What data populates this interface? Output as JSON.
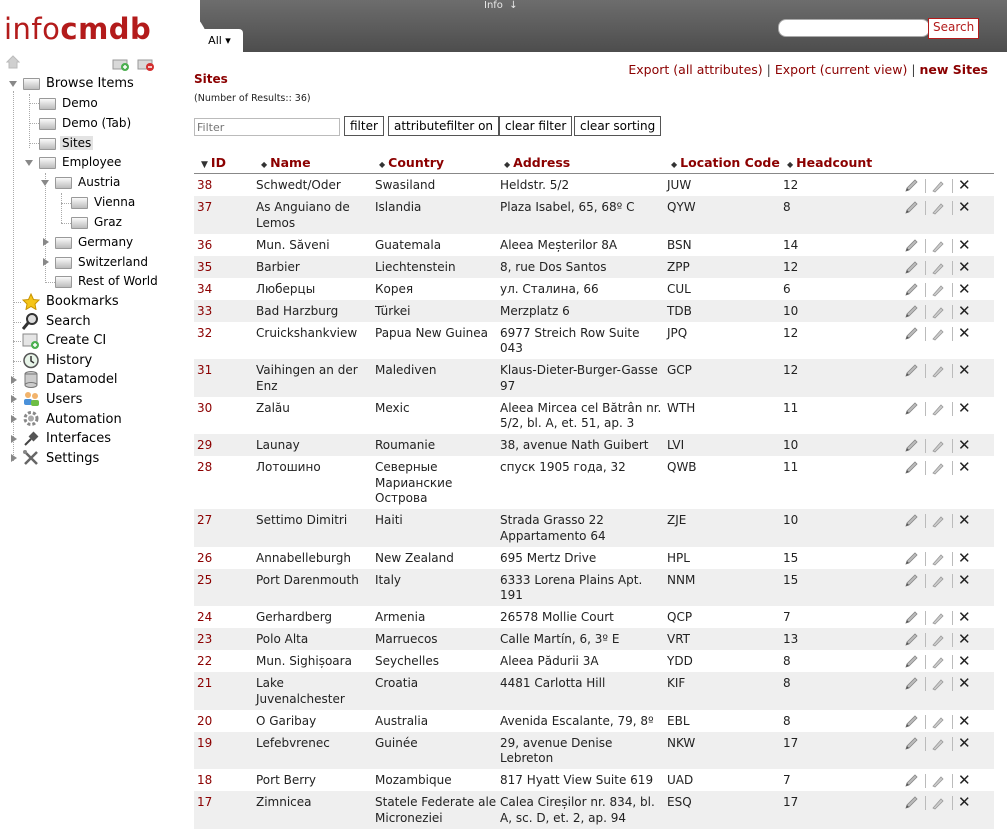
{
  "header": {
    "logo_part1": "info",
    "logo_part2": "cmdb",
    "info_label": "Info",
    "info_arrow": "↓",
    "tab_all": "All ▾",
    "search_placeholder": "",
    "search_button": "Search"
  },
  "sidebar": {
    "browse_items": "Browse Items",
    "demo": "Demo",
    "demo_tab": "Demo (Tab)",
    "sites": "Sites",
    "employee": "Employee",
    "austria": "Austria",
    "vienna": "Vienna",
    "graz": "Graz",
    "germany": "Germany",
    "switzerland": "Switzerland",
    "rest_of_world": "Rest of World",
    "bookmarks": "Bookmarks",
    "search": "Search",
    "create_ci": "Create CI",
    "history": "History",
    "datamodel": "Datamodel",
    "users": "Users",
    "automation": "Automation",
    "interfaces": "Interfaces",
    "settings": "Settings"
  },
  "main": {
    "title": "Sites",
    "result_count": "(Number of Results:: 36)",
    "export_all": "Export (all attributes)",
    "export_current": "Export (current view)",
    "new_sites": "new Sites",
    "separator": "|",
    "filter_placeholder": "Filter",
    "btn_filter": "filter",
    "btn_attributefilter": "attributefilter on",
    "btn_clear_filter": "clear filter",
    "btn_clear_sorting": "clear sorting"
  },
  "table": {
    "columns": [
      "ID",
      "Name",
      "Country",
      "Address",
      "Location Code",
      "Headcount"
    ],
    "sort_desc_glyph": "▼",
    "sort_both_glyph": "⬍",
    "rows": [
      {
        "id": "38",
        "name": [
          "Schwedt/Oder"
        ],
        "country": [
          "Swasiland"
        ],
        "address": [
          "Heldstr. 5/2"
        ],
        "code": "JUW",
        "headcount": "12"
      },
      {
        "id": "37",
        "name": [
          "As Anguiano de",
          "Lemos"
        ],
        "country": [
          "Islandia"
        ],
        "address": [
          "Plaza Isabel, 65, 68º C"
        ],
        "code": "QYW",
        "headcount": "8"
      },
      {
        "id": "36",
        "name": [
          "Mun. Săveni"
        ],
        "country": [
          "Guatemala"
        ],
        "address": [
          "Aleea Meșterilor 8A"
        ],
        "code": "BSN",
        "headcount": "14"
      },
      {
        "id": "35",
        "name": [
          "Barbier"
        ],
        "country": [
          "Liechtenstein"
        ],
        "address": [
          "8, rue Dos Santos"
        ],
        "code": "ZPP",
        "headcount": "12"
      },
      {
        "id": "34",
        "name": [
          "Люберцы"
        ],
        "country": [
          "Корея"
        ],
        "address": [
          "ул. Сталина, 66"
        ],
        "code": "CUL",
        "headcount": "6"
      },
      {
        "id": "33",
        "name": [
          "Bad Harzburg"
        ],
        "country": [
          "Türkei"
        ],
        "address": [
          "Merzplatz 6"
        ],
        "code": "TDB",
        "headcount": "10"
      },
      {
        "id": "32",
        "name": [
          "Cruickshankview"
        ],
        "country": [
          "Papua New Guinea"
        ],
        "address": [
          "6977 Streich Row Suite",
          "043"
        ],
        "code": "JPQ",
        "headcount": "12"
      },
      {
        "id": "31",
        "name": [
          "Vaihingen an der",
          "Enz"
        ],
        "country": [
          "Malediven"
        ],
        "address": [
          "Klaus-Dieter-Burger-Gasse",
          "97"
        ],
        "code": "GCP",
        "headcount": "12"
      },
      {
        "id": "30",
        "name": [
          "Zalău"
        ],
        "country": [
          "Mexic"
        ],
        "address": [
          "Aleea Mircea cel Bătrân nr.",
          "5/2, bl. A, et. 51, ap. 3"
        ],
        "code": "WTH",
        "headcount": "11"
      },
      {
        "id": "29",
        "name": [
          "Launay"
        ],
        "country": [
          "Roumanie"
        ],
        "address": [
          "38, avenue Nath Guibert"
        ],
        "code": "LVI",
        "headcount": "10"
      },
      {
        "id": "28",
        "name": [
          "Лотошино"
        ],
        "country": [
          "Северные",
          "Марианские",
          "Острова"
        ],
        "address": [
          "спуск 1905 года, 32"
        ],
        "code": "QWB",
        "headcount": "11"
      },
      {
        "id": "27",
        "name": [
          "Settimo Dimitri"
        ],
        "country": [
          "Haiti"
        ],
        "address": [
          "Strada Grasso 22",
          "Appartamento 64"
        ],
        "code": "ZJE",
        "headcount": "10"
      },
      {
        "id": "26",
        "name": [
          "Annabelleburgh"
        ],
        "country": [
          "New Zealand"
        ],
        "address": [
          "695 Mertz Drive"
        ],
        "code": "HPL",
        "headcount": "15"
      },
      {
        "id": "25",
        "name": [
          "Port Darenmouth"
        ],
        "country": [
          "Italy"
        ],
        "address": [
          "6333 Lorena Plains Apt.",
          "191"
        ],
        "code": "NNM",
        "headcount": "15"
      },
      {
        "id": "24",
        "name": [
          "Gerhardberg"
        ],
        "country": [
          "Armenia"
        ],
        "address": [
          "26578 Mollie Court"
        ],
        "code": "QCP",
        "headcount": "7"
      },
      {
        "id": "23",
        "name": [
          "Polo Alta"
        ],
        "country": [
          "Marruecos"
        ],
        "address": [
          "Calle Martín, 6, 3º E"
        ],
        "code": "VRT",
        "headcount": "13"
      },
      {
        "id": "22",
        "name": [
          "Mun. Sighișoara"
        ],
        "country": [
          "Seychelles"
        ],
        "address": [
          "Aleea Pădurii 3A"
        ],
        "code": "YDD",
        "headcount": "8"
      },
      {
        "id": "21",
        "name": [
          "Lake",
          "Juvenalchester"
        ],
        "country": [
          "Croatia"
        ],
        "address": [
          "4481 Carlotta Hill"
        ],
        "code": "KIF",
        "headcount": "8"
      },
      {
        "id": "20",
        "name": [
          "O Garibay"
        ],
        "country": [
          "Australia"
        ],
        "address": [
          "Avenida Escalante, 79, 8º"
        ],
        "code": "EBL",
        "headcount": "8"
      },
      {
        "id": "19",
        "name": [
          "Lefebvrenec"
        ],
        "country": [
          "Guinée"
        ],
        "address": [
          "29, avenue Denise",
          "Lebreton"
        ],
        "code": "NKW",
        "headcount": "17"
      },
      {
        "id": "18",
        "name": [
          "Port Berry"
        ],
        "country": [
          "Mozambique"
        ],
        "address": [
          "817 Hyatt View Suite 619"
        ],
        "code": "UAD",
        "headcount": "7"
      },
      {
        "id": "17",
        "name": [
          "Zimnicea"
        ],
        "country": [
          "Statele Federate ale",
          "Microneziei"
        ],
        "address": [
          "Calea Cireșilor nr. 834, bl.",
          "A, sc. D, et. 2, ap. 94"
        ],
        "code": "ESQ",
        "headcount": "17"
      }
    ]
  },
  "colors": {
    "brand": "#b31b1b",
    "link": "#8b0000",
    "topbar": "#5a5a5a",
    "row_alt": "#efefef"
  },
  "icons": {
    "row_edit": "pencil-icon",
    "row_edit_alt": "pen-icon",
    "row_delete": "close-icon"
  }
}
